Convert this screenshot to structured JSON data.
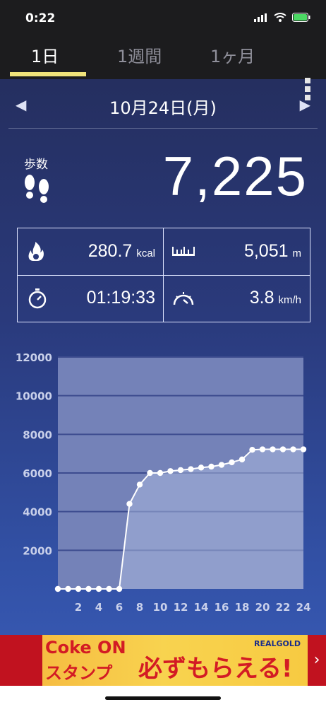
{
  "status_bar": {
    "time": "0:22"
  },
  "tabs": [
    {
      "label": "1日",
      "active": true
    },
    {
      "label": "1週間",
      "active": false
    },
    {
      "label": "1ヶ月",
      "active": false
    }
  ],
  "date_nav": {
    "date": "10月24日(月)",
    "prev_icon": "triangle-left-icon",
    "next_icon": "triangle-right-icon"
  },
  "steps": {
    "label": "歩数",
    "value": "7,225"
  },
  "stats": {
    "calories": {
      "value": "280.7",
      "unit": "kcal"
    },
    "distance": {
      "value": "5,051",
      "unit": "m"
    },
    "duration": {
      "value": "01:19:33"
    },
    "speed": {
      "value": "3.8",
      "unit": "km/h"
    }
  },
  "colors": {
    "accent_underline": "#f0e37a",
    "plot_fill": "#a8b6dc",
    "line": "#ffffff"
  },
  "chart_data": {
    "type": "area",
    "title": "",
    "xlabel": "",
    "ylabel": "",
    "x": [
      0,
      1,
      2,
      3,
      4,
      5,
      6,
      7,
      8,
      9,
      10,
      11,
      12,
      13,
      14,
      15,
      16,
      17,
      18,
      19,
      20,
      21,
      22,
      23,
      24
    ],
    "values": [
      0,
      0,
      0,
      0,
      0,
      0,
      0,
      4400,
      5400,
      6000,
      6000,
      6100,
      6150,
      6200,
      6280,
      6330,
      6420,
      6550,
      6700,
      7200,
      7225,
      7225,
      7225,
      7225,
      7225
    ],
    "xticks": [
      "2",
      "4",
      "6",
      "8",
      "10",
      "12",
      "14",
      "16",
      "18",
      "20",
      "22",
      "24"
    ],
    "yticks": [
      "2000",
      "4000",
      "6000",
      "8000",
      "10000",
      "12000"
    ],
    "ylim": [
      0,
      12000
    ],
    "grid": true
  },
  "ad": {
    "line1": "Coke ON",
    "line2": "スタンプ",
    "line3": "必ずもらえる!",
    "brand": "REALGOLD",
    "next_label": "›"
  }
}
